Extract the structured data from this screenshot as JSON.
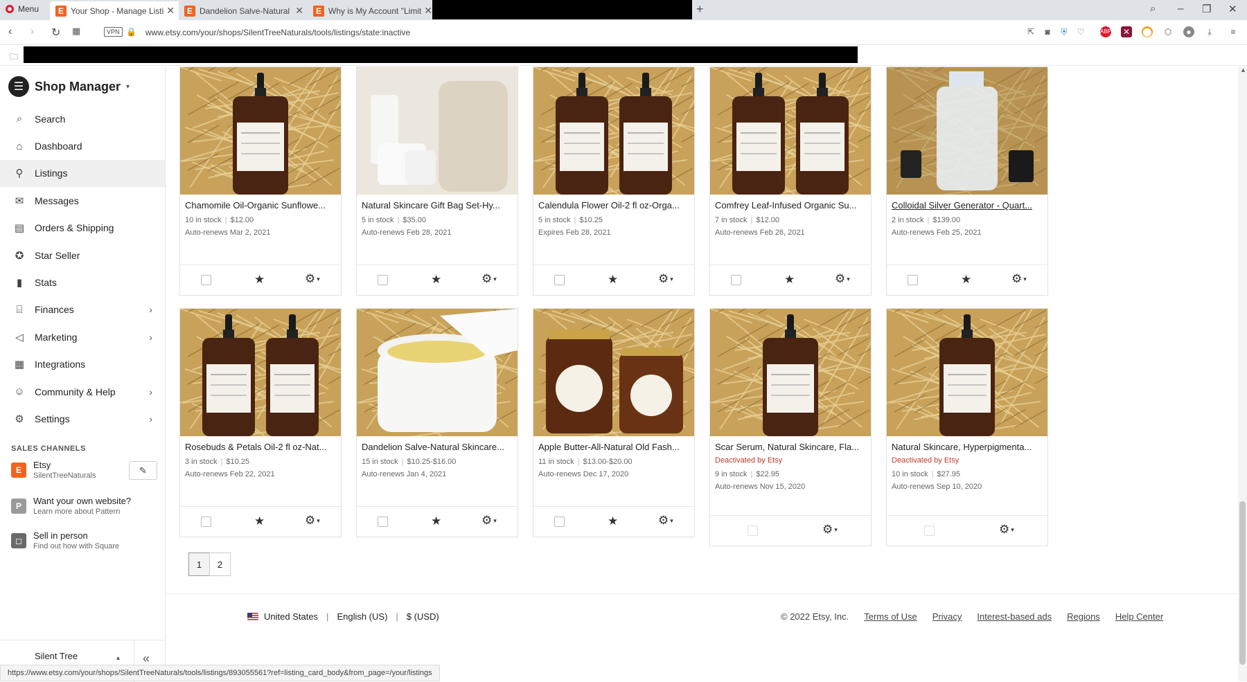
{
  "browser": {
    "menu_label": "Menu",
    "tabs": [
      {
        "label": "Your Shop - Manage Listin",
        "favicon": "E"
      },
      {
        "label": "Dandelion Salve-Natural S",
        "favicon": "E"
      },
      {
        "label": "Why is My Account \"Limite",
        "favicon": "E"
      }
    ],
    "vpn": "VPN",
    "url": "www.etsy.com/your/shops/SilentTreeNaturals/tools/listings/state:inactive",
    "status_url": "https://www.etsy.com/your/shops/SilentTreeNaturals/tools/listings/893055561?ref=listing_card_body&from_page=/your/listings"
  },
  "sidebar": {
    "title": "Shop Manager",
    "items": [
      {
        "label": "Search",
        "icon": "search-icon",
        "glyph": "⌕"
      },
      {
        "label": "Dashboard",
        "icon": "home-icon",
        "glyph": "⌂"
      },
      {
        "label": "Listings",
        "icon": "listings-icon",
        "glyph": "⚲"
      },
      {
        "label": "Messages",
        "icon": "mail-icon",
        "glyph": "✉"
      },
      {
        "label": "Orders & Shipping",
        "icon": "clipboard-icon",
        "glyph": "▤"
      },
      {
        "label": "Star Seller",
        "icon": "star-badge-icon",
        "glyph": "✪"
      },
      {
        "label": "Stats",
        "icon": "bar-chart-icon",
        "glyph": "▮"
      },
      {
        "label": "Finances",
        "icon": "bank-icon",
        "glyph": "⌸"
      },
      {
        "label": "Marketing",
        "icon": "megaphone-icon",
        "glyph": "◁"
      },
      {
        "label": "Integrations",
        "icon": "grid-icon",
        "glyph": "▦"
      },
      {
        "label": "Community & Help",
        "icon": "people-icon",
        "glyph": "☺"
      },
      {
        "label": "Settings",
        "icon": "gear-icon",
        "glyph": "⚙"
      }
    ],
    "sales_channels_heading": "SALES CHANNELS",
    "channels": [
      {
        "title": "Etsy",
        "subtitle": "SilentTreeNaturals",
        "badge": "E",
        "color": "#f1641e"
      },
      {
        "title": "Want your own website?",
        "subtitle": "Learn more about Pattern",
        "badge": "P",
        "color": "#9a9a9a"
      },
      {
        "title": "Sell in person",
        "subtitle": "Find out how with Square",
        "badge": "◻",
        "color": "#6a6a6a"
      }
    ],
    "shop_name": "Silent Tree Naturals"
  },
  "listings": [
    {
      "title": "Chamomile Oil-Organic Sunflowe...",
      "stock": "10 in stock",
      "price": "$12.00",
      "renew": "Auto-renews Mar 2, 2021",
      "photo": "oil-bottle"
    },
    {
      "title": "Natural Skincare Gift Bag Set-Hy...",
      "stock": "5 in stock",
      "price": "$35.00",
      "renew": "Auto-renews Feb 28, 2021",
      "photo": "gift-bag"
    },
    {
      "title": "Calendula Flower Oil-2 fl oz-Orga...",
      "stock": "5 in stock",
      "price": "$10.25",
      "renew": "Expires Feb 28, 2021",
      "photo": "two-bottles"
    },
    {
      "title": "Comfrey Leaf-Infused Organic Su...",
      "stock": "7 in stock",
      "price": "$12.00",
      "renew": "Auto-renews Feb 28, 2021",
      "photo": "two-bottles"
    },
    {
      "title": "Colloidal Silver Generator - Quart...",
      "stock": "2 in stock",
      "price": "$139.00",
      "renew": "Auto-renews Feb 25, 2021",
      "photo": "jar-generator",
      "link": true
    },
    {
      "title": "Rosebuds & Petals Oil-2 fl oz-Nat...",
      "stock": "3 in stock",
      "price": "$10.25",
      "renew": "Auto-renews Feb 22, 2021",
      "photo": "two-bottles"
    },
    {
      "title": "Dandelion Salve-Natural Skincare...",
      "stock": "15 in stock",
      "price": "$10.25-$16.00",
      "renew": "Auto-renews Jan 4, 2021",
      "photo": "salve-jar"
    },
    {
      "title": "Apple Butter-All-Natural Old Fash...",
      "stock": "11 in stock",
      "price": "$13.00-$20.00",
      "renew": "Auto-renews Dec 17, 2020",
      "photo": "apple-jars"
    },
    {
      "title": "Scar Serum, Natural Skincare, Fla...",
      "deactivated": "Deactivated by Etsy",
      "stock": "9 in stock",
      "price": "$22.95",
      "renew": "Auto-renews Nov 15, 2020",
      "photo": "oil-bottle"
    },
    {
      "title": "Natural Skincare, Hyperpigmenta...",
      "deactivated": "Deactivated by Etsy",
      "stock": "10 in stock",
      "price": "$27.95",
      "renew": "Auto-renews Sep 10, 2020",
      "photo": "oil-bottle"
    }
  ],
  "pagination": {
    "pages": [
      "1",
      "2"
    ],
    "current": "1"
  },
  "footer": {
    "country": "United States",
    "language": "English (US)",
    "currency": "$ (USD)",
    "copyright": "© 2022 Etsy, Inc.",
    "links": [
      "Terms of Use",
      "Privacy",
      "Interest-based ads",
      "Regions",
      "Help Center"
    ]
  },
  "colors": {
    "etsy_orange": "#f1641e",
    "deactivated_red": "#c0392b",
    "straw": "#c8a15a"
  }
}
